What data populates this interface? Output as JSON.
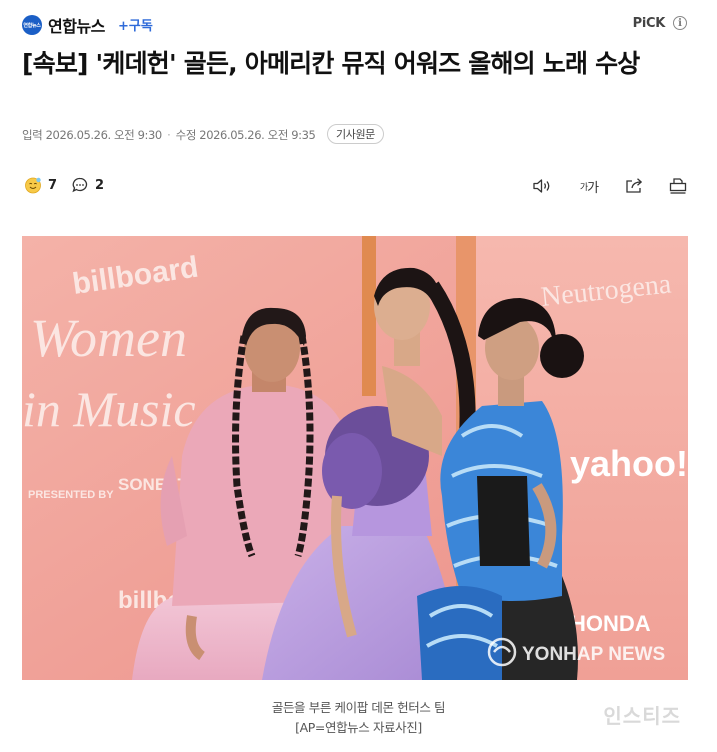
{
  "header": {
    "logo_text": "연합뉴스",
    "press_name": "연합뉴스",
    "subscribe_label": "+구독",
    "pick_label": "PiCK",
    "info_symbol": "i"
  },
  "article": {
    "title": "[속보] '케데헌' 골든, 아메리칸 뮤직 어워즈 올해의 노래 수상",
    "input_label": "입력",
    "input_time": "2026.05.26. 오전 9:30",
    "separator": "·",
    "edit_label": "수정",
    "edit_time": "2026.05.26. 오전 9:35",
    "original_button": "기사원문"
  },
  "actions": {
    "reaction_count": "7",
    "comment_count": "2",
    "font_size_label_small": "가",
    "font_size_label_large": "가"
  },
  "photo": {
    "billboard_top": "billboard",
    "women": "Women",
    "in_music": "in Music",
    "presented_by": "PRESENTED BY",
    "sonesta": "SONESTA",
    "billboard_bottom": "billboard",
    "neutrogena": "Neutrogena",
    "yahoo": "yahoo!",
    "honda": "HONDA",
    "agency_watermark": "YONHAP NEWS"
  },
  "caption": {
    "line1": "골든을 부른 케이팝 데몬 헌터스 팀",
    "line2": "[AP=연합뉴스 자료사진]"
  },
  "site_watermark": "인스티즈",
  "colors": {
    "accent_blue": "#2f6bd9",
    "logo_blue": "#1b5fc6",
    "backdrop_pink": "#f2a69e"
  }
}
